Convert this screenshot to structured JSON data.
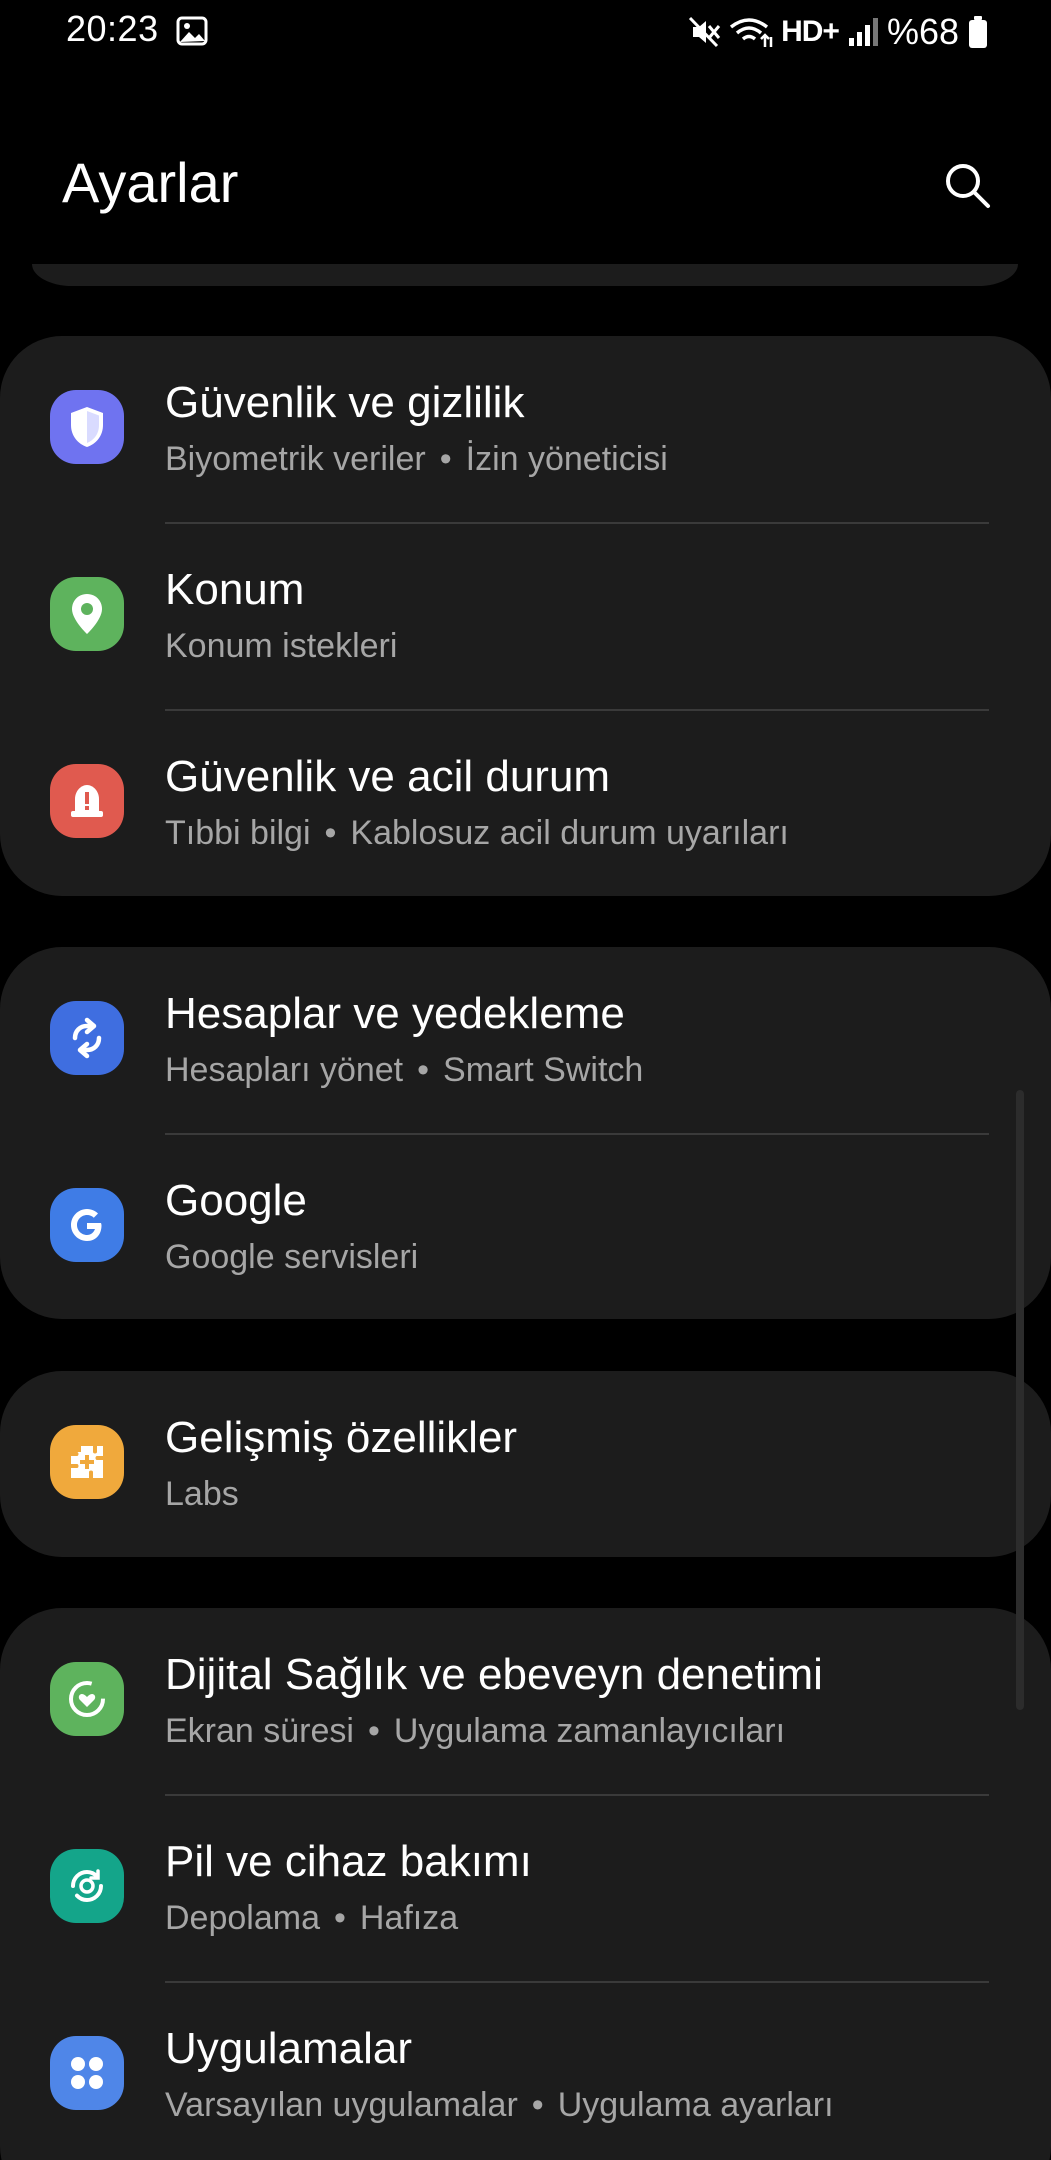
{
  "status_bar": {
    "time": "20:23",
    "network": "HD+",
    "battery": "%68",
    "icons": [
      "gallery-icon",
      "mute-icon",
      "wifi-icon",
      "signal-icon",
      "battery-icon"
    ]
  },
  "header": {
    "title": "Ayarlar",
    "search_icon": "search-icon"
  },
  "groups": [
    {
      "items": [
        {
          "title": "Güvenlik ve gizlilik",
          "sub1": "Biyometrik veriler",
          "sub2": "İzin yöneticisi",
          "icon": "shield-icon",
          "color": "#6f73f0"
        },
        {
          "title": "Konum",
          "sub1": "Konum istekleri",
          "icon": "location-pin-icon",
          "color": "#5eb35d"
        },
        {
          "title": "Güvenlik ve acil durum",
          "sub1": "Tıbbi bilgi",
          "sub2": "Kablosuz acil durum uyarıları",
          "icon": "emergency-alert-icon",
          "color": "#e05a4f"
        }
      ]
    },
    {
      "items": [
        {
          "title": "Hesaplar ve yedekleme",
          "sub1": "Hesapları yönet",
          "sub2": "Smart Switch",
          "icon": "sync-icon",
          "color": "#3f6ee0"
        },
        {
          "title": "Google",
          "sub1": "Google servisleri",
          "icon": "google-icon",
          "color": "#3f7ce6"
        }
      ]
    },
    {
      "items": [
        {
          "title": "Gelişmiş özellikler",
          "sub1": "Labs",
          "icon": "puzzle-plus-icon",
          "color": "#f0a93c"
        }
      ]
    },
    {
      "items": [
        {
          "title": "Dijital Sağlık ve ebeveyn denetimi",
          "sub1": "Ekran süresi",
          "sub2": "Uygulama zamanlayıcıları",
          "icon": "digital-wellbeing-icon",
          "color": "#5eb35d"
        },
        {
          "title": "Pil ve cihaz bakımı",
          "sub1": "Depolama",
          "sub2": "Hafıza",
          "icon": "device-care-icon",
          "color": "#14a58a"
        },
        {
          "title": "Uygulamalar",
          "sub1": "Varsayılan uygulamalar",
          "sub2": "Uygulama ayarları",
          "icon": "apps-grid-icon",
          "color": "#4f86e8"
        }
      ]
    }
  ]
}
